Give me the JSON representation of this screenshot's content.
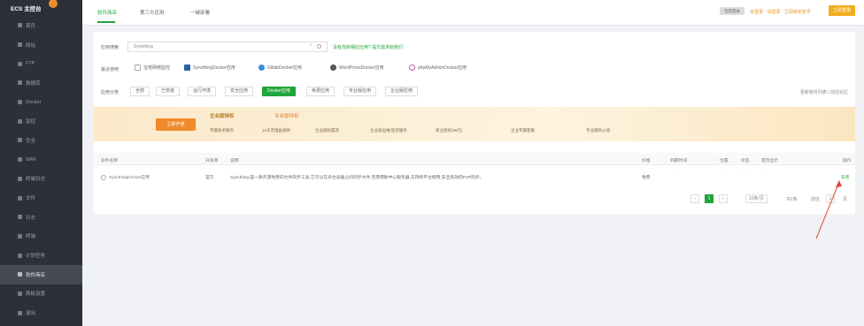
{
  "sidebar": {
    "title": "ECS 主控台",
    "items": [
      {
        "label": "首页"
      },
      {
        "label": "网站"
      },
      {
        "label": "FTP"
      },
      {
        "label": "数据库"
      },
      {
        "label": "Docker"
      },
      {
        "label": "监控"
      },
      {
        "label": "安全"
      },
      {
        "label": "WAF"
      },
      {
        "label": "终端日志"
      },
      {
        "label": "文件"
      },
      {
        "label": "日志"
      },
      {
        "label": "终端"
      },
      {
        "label": "计划任务"
      },
      {
        "label": "软件商店",
        "active": true
      },
      {
        "label": "面板设置"
      },
      {
        "label": "退出"
      }
    ]
  },
  "topbar": {
    "tabs": [
      "软件商店",
      "第三方应用",
      "一键部署"
    ],
    "login_label": "宝塔登录",
    "notice": "未登录 · 请登录 · 立即绑定账号",
    "button": "立即登录"
  },
  "search": {
    "label": "应用搜索",
    "value": "Syncthing",
    "hint": "没有找到相应应用? 提交需求给我们"
  },
  "recommend": {
    "label": "最近使用",
    "items": [
      "宝塔网络监控",
      "SyncthingDocker应用",
      "GitlabDocker应用",
      "WordPressDocker应用",
      "phpMyAdminDocker应用"
    ]
  },
  "categories": {
    "label": "应用分类",
    "items": [
      "全部",
      "已安装",
      "运行环境",
      "安全应用",
      "Docker应用",
      "免费应用",
      "专业版应用",
      "企业版应用"
    ],
    "active_index": 4,
    "right_text": "更新软件列表 / 前往社区"
  },
  "promo": {
    "tag": "立即开通",
    "title1": "企业版特权",
    "title2": "专业版特权",
    "features": [
      "专属技术服务",
      "10天无理由退款",
      "企业级防篡改",
      "企业级运维/监控服务",
      "商业授权(99元)",
      "企业专属客服",
      "专业版防火墙"
    ]
  },
  "table": {
    "headers": [
      "软件名称",
      "开发商",
      "说明",
      "价格",
      "到期时间",
      "位置",
      "状态",
      "首页显示",
      "操作"
    ],
    "rows": [
      {
        "name": "SyncthingDocker应用",
        "dev": "官方",
        "desc": "Syncthing 是一款开源免费的文件同步工具,它可以在多台设备之间同步文件,无需借助中心服务器,支持跨平台使用,安全高效的P2P同步。",
        "price": "免费",
        "expire": "--",
        "location": "--",
        "status": "--",
        "home": "--",
        "action": "安装"
      }
    ]
  },
  "pagination": {
    "prev": "‹",
    "pages": [
      "1"
    ],
    "next": "›",
    "per_page": "10条/页",
    "total": "共1条",
    "goto_label": "前往",
    "goto_value": "1",
    "page_unit": "页"
  },
  "colors": {
    "accent": "#20a53a",
    "sidebar_bg": "#2d3038",
    "warning": "#f0ad1e"
  }
}
